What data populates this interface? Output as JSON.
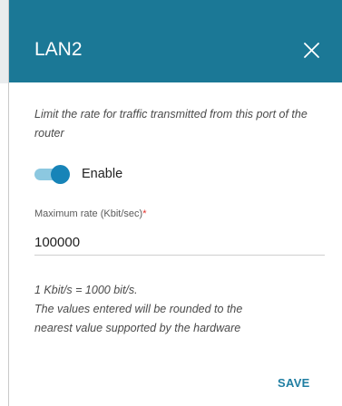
{
  "dialog": {
    "title": "LAN2",
    "description": "Limit the rate for traffic transmitted from this port of the router",
    "toggle": {
      "label": "Enable",
      "checked": true
    },
    "rate_field": {
      "label": "Maximum rate (Kbit/sec)",
      "required_mark": "*",
      "value": "100000"
    },
    "note_lines": [
      "1 Kbit/s = 1000 bit/s.",
      "The values entered will be rounded to the",
      "nearest value supported by the hardware"
    ],
    "save_label": "SAVE"
  },
  "colors": {
    "header_bg": "#1b7896",
    "accent": "#1784b8",
    "required": "#e0312b",
    "save_text": "#1f7ea2"
  },
  "icons": {
    "close": "close-icon"
  }
}
